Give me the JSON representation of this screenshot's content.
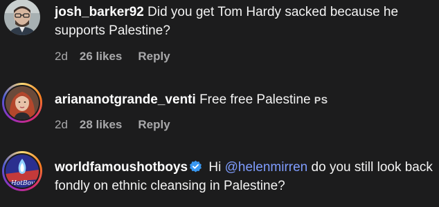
{
  "comments": [
    {
      "username": "josh_barker92",
      "text": "Did you get Tom Hardy sacked because he supports Palestine?",
      "time": "2d",
      "likes": "26 likes",
      "reply": "Reply",
      "avatar_icon": "man-with-glasses-avatar"
    },
    {
      "username": "ariananotgrande_venti",
      "text": "Free free Palestine",
      "suffix": "PS",
      "time": "2d",
      "likes": "28 likes",
      "reply": "Reply",
      "avatar_icon": "red-haired-woman-avatar",
      "has_story_ring": true
    },
    {
      "username": "worldfamoushotboys",
      "verified": true,
      "text_prefix": "Hi",
      "mention": "@helenmirren",
      "text": "do you still look back fondly on ethnic cleansing in Palestine?",
      "avatar_icon": "hotboys-logo-avatar",
      "has_story_ring": true
    }
  ],
  "colors": {
    "background": "#1c1c1d",
    "mention": "#7f9dff",
    "meta": "#a9a9ab",
    "verified": "#3897f0"
  }
}
